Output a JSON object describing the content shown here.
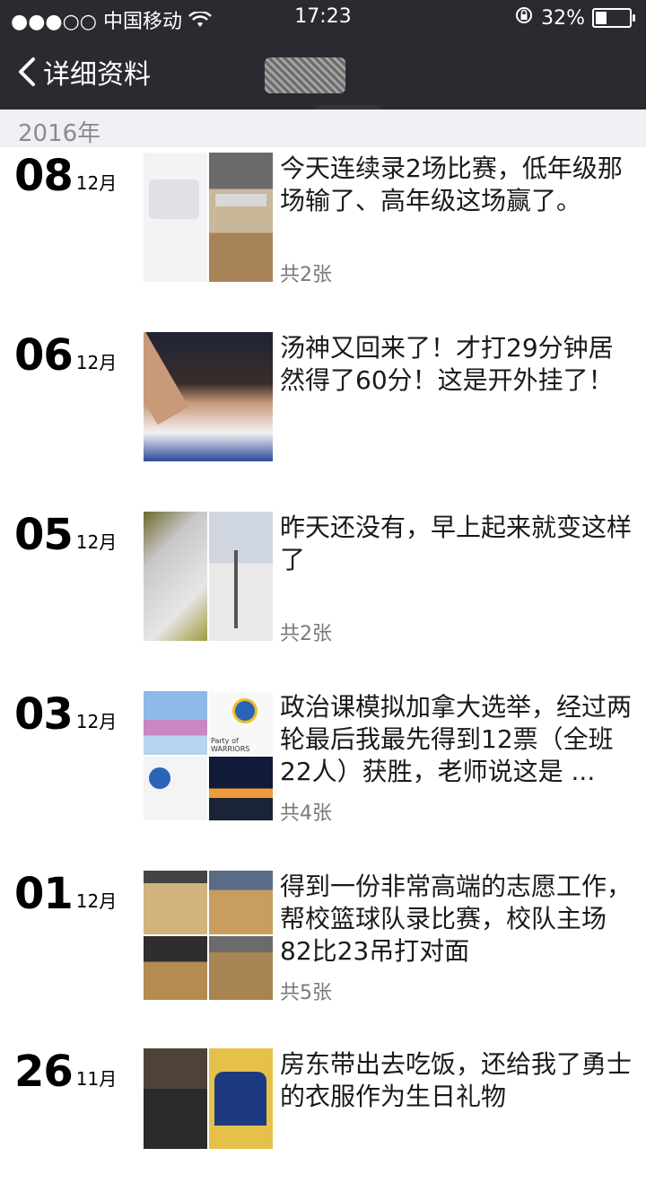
{
  "status_bar": {
    "signal": "●●●○○",
    "carrier": "中国移动",
    "time": "17:23",
    "battery_text": "32%",
    "battery_level": 0.32
  },
  "nav": {
    "back_label": "详细资料"
  },
  "year_header": "2016年",
  "posts": [
    {
      "day": "08",
      "month": "12月",
      "text": "今天连续录2场比赛，低年级那场输了、高年级这场赢了。",
      "count": "共2张"
    },
    {
      "day": "06",
      "month": "12月",
      "text": "汤神又回来了！才打29分钟居然得了60分！这是开外挂了！",
      "count": ""
    },
    {
      "day": "05",
      "month": "12月",
      "text": "昨天还没有，早上起来就变这样了",
      "count": "共2张"
    },
    {
      "day": "03",
      "month": "12月",
      "text": "政治课模拟加拿大选举，经过两轮最后我最先得到12票（全班22人）获胜，老师说这是 ...",
      "count": "共4张"
    },
    {
      "day": "01",
      "month": "12月",
      "text": "得到一份非常高端的志愿工作，帮校篮球队录比赛，校队主场82比23吊打对面",
      "count": "共5张"
    },
    {
      "day": "26",
      "month": "11月",
      "text": "房东带出去吃饭，还给我了勇士的衣服作为生日礼物",
      "count": ""
    }
  ]
}
